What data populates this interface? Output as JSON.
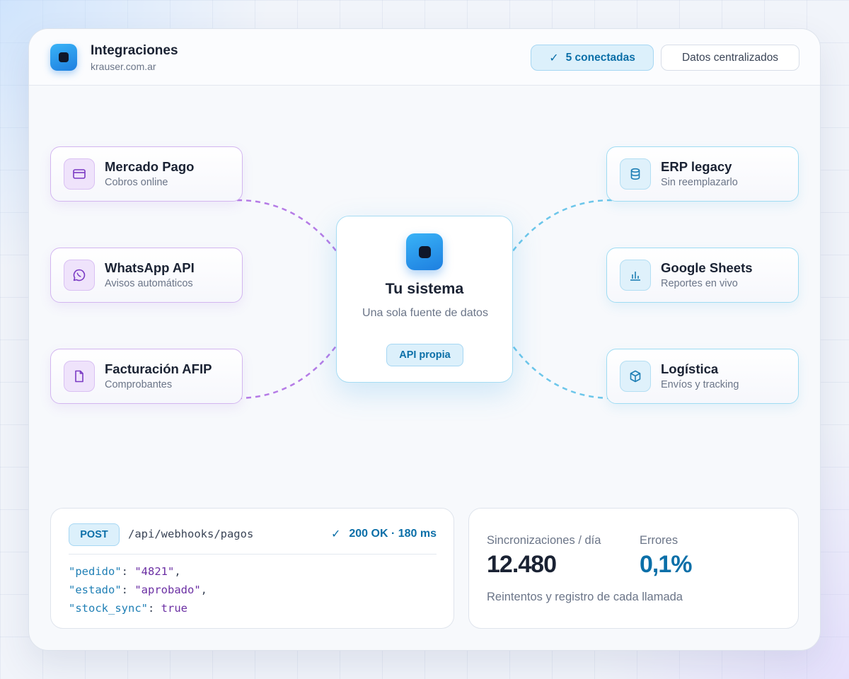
{
  "header": {
    "title": "Integraciones",
    "subtitle": "krauser.com.ar",
    "connected_badge": "5 conectadas",
    "secondary_badge": "Datos centralizados"
  },
  "center": {
    "title": "Tu sistema",
    "subtitle": "Una sola fuente de datos",
    "badge": "API propia"
  },
  "left_nodes": [
    {
      "title": "Mercado Pago",
      "subtitle": "Cobros online",
      "icon": "credit-card-icon"
    },
    {
      "title": "WhatsApp API",
      "subtitle": "Avisos automáticos",
      "icon": "whatsapp-icon"
    },
    {
      "title": "Facturación AFIP",
      "subtitle": "Comprobantes",
      "icon": "document-icon"
    }
  ],
  "right_nodes": [
    {
      "title": "ERP legacy",
      "subtitle": "Sin reemplazarlo",
      "icon": "database-icon"
    },
    {
      "title": "Google Sheets",
      "subtitle": "Reportes en vivo",
      "icon": "bar-chart-icon"
    },
    {
      "title": "Logística",
      "subtitle": "Envíos y tracking",
      "icon": "package-icon"
    }
  ],
  "api_card": {
    "method": "POST",
    "endpoint": "/api/webhooks/pagos",
    "status": "200 OK · 180 ms",
    "lines": [
      {
        "key": "\"pedido\"",
        "sep": ": ",
        "value": "\"4821\"",
        "end": ","
      },
      {
        "key": "\"estado\"",
        "sep": ": ",
        "value": "\"aprobado\"",
        "end": ","
      },
      {
        "key": "\"stock_sync\"",
        "sep": ": ",
        "value": "true",
        "end": ""
      }
    ]
  },
  "stats_card": {
    "sync_label": "Sincronizaciones / día",
    "sync_value": "12.480",
    "errors_label": "Errores",
    "errors_value": "0,1%",
    "note": "Reintentos y registro de cada llamada"
  },
  "colors": {
    "accent_blue": "#0b6fa8",
    "link_purple": "#b57be6",
    "link_blue": "#6cc6ea"
  }
}
